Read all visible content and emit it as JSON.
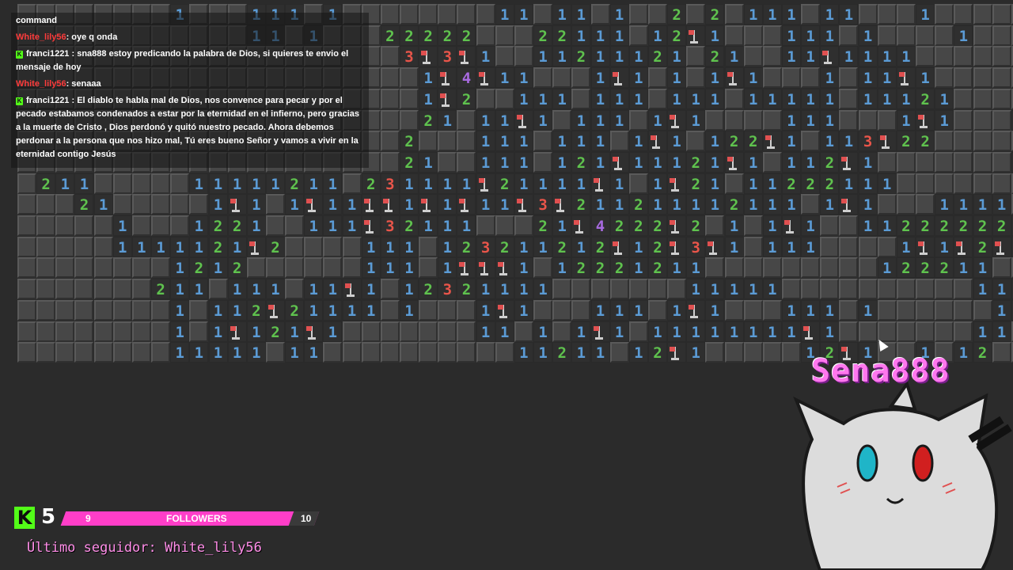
{
  "chat": {
    "header": "command",
    "messages": [
      {
        "user": "White_lily56",
        "text": ": oye q onda",
        "badge": false,
        "color": "#ff3b3b"
      },
      {
        "user": "franci1221",
        "text": " : sna888 estoy predicando la palabra de Dios, si quieres te envio el mensaje de hoy",
        "badge": true,
        "color": "#ffffff"
      },
      {
        "user": "White_lily56",
        "text": ": senaaa",
        "badge": false,
        "color": "#ff3b3b"
      },
      {
        "user": "franci1221",
        "text": " : El diablo te habla mal de Dios, nos convence para pecar y por el pecado estabamos condenados a estar por la eternidad en el infierno, pero gracias a la muerte de Cristo , Dios perdonó y quitó nuestro pecado. Ahora debemos perdonar a la persona que nos hizo mal, Tú eres bueno Señor y vamos a vivir en la eternidad contigo Jesús",
        "badge": true,
        "color": "#ffffff"
      }
    ]
  },
  "overlay": {
    "kick_count": "5",
    "goal_current": "9",
    "goal_label": "FOLLOWERS",
    "goal_target": "10",
    "goal_progress": 0.9,
    "last_follower": "Último seguidor: White_lily56",
    "mascot_name": "Sena888"
  },
  "colors": {
    "num1": "#5b9bd5",
    "num2": "#5fc24e",
    "num3": "#e8554a",
    "num4": "#a86ae0",
    "covered": "#474747",
    "open": "#2f2f2f",
    "kick_green": "#53fc18",
    "goal_pink": "#ff3ec8"
  },
  "board": {
    "rows": [
      "CCCCCCCC1CCC111C1CCCCCCCC11C11C1CC2C2C111C11CCC1CCCCCC",
      "CCCCCCCCCCCC11C1CCC22222CCC22111C12F1CCC111C1CCCC1CCCCC",
      "CCCCCCCCCCCCCCCCCCCC3F3F1CC11211121C21CC11F1111CCCCCCC",
      "CCCCCCCCCCCCCCCCCCCCC1F4F11CCC1F1C1C1F1CCC1C11F1CCCCCC",
      "CCCCCCCCCCCCCCCCCCCCC1F2CC111C111C111C11111C11121CCCCC",
      "CCCCCCCCCCCCCCCCCCCCC21C11F1C111C1F1CCCC111CCC1F1CCC1C",
      "CCCCCCCCCCCCCCCCCCCC2CCC111C111C1F1C122F1C113F22CCCCC1",
      "CCCCCCCCCCCCCCCCCCCC21CC111C121F11121F1C112F1CCCCCCC1C",
      "C211CCCCC11111211C231111F21111F1C1F21C11222111CCCCCCCC",
      "CCC21CCCCC1F1C1F11FF1F1F11F3F211211112111C1F1CCC1111C",
      "CCCCC1CCC1221CC111F32111CCC21F4222F2C1C1F1CC11222222F11",
      "CCCCC1111121F2CCCC111C123211212F12F3F1C111CCCC1F1F2F21C",
      "CCCCCCCC1212CCCCCC111C1FFF1C12221211CCCCCCCCC122211CCCC",
      "CCCCCCC211C111C11F1C12321111CCCCCCC11111CCCCCCCCCC111",
      "CCCCCCCC1C112F21111C1CCC1F1CCC111C1F1CCC111C1CCCCCC1F1",
      "CCCCCCCC1C1F121F1CCCCCCC11C1C1F1C11111111F1CCCCCCC11C",
      "CCCCCCCC11111C11CCCCCCCCCC11211C12F1CCCCC12F1CC1C12CC2"
    ]
  }
}
